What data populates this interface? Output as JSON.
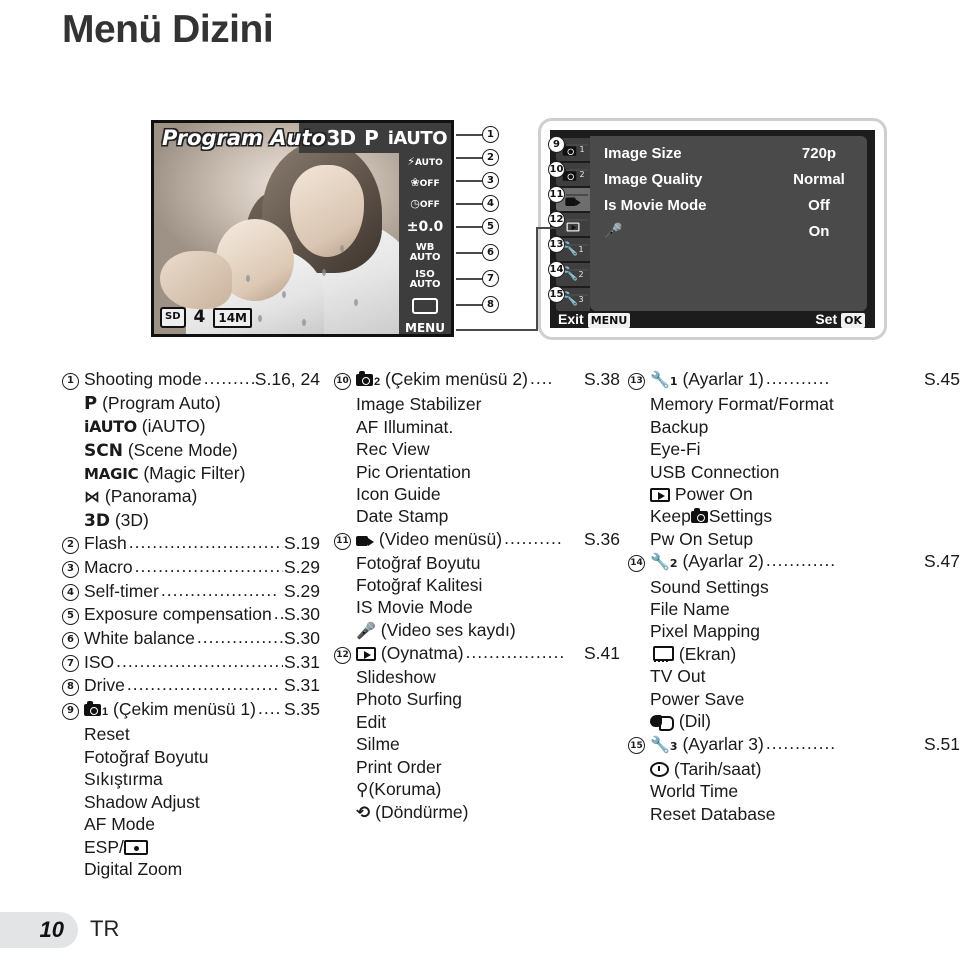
{
  "page": {
    "title": "Menü Dizini",
    "page_number": "10",
    "language_code": "TR"
  },
  "live_view": {
    "mode_title": "Program Auto",
    "top_icons": [
      "3D",
      "P",
      "iAUTO"
    ],
    "side_items": [
      {
        "num": "2",
        "line1": "AUTO",
        "icon": "flash-icon"
      },
      {
        "num": "3",
        "line1": "OFF",
        "icon": "macro-icon"
      },
      {
        "num": "4",
        "line1": "OFF",
        "icon": "self-timer-icon"
      },
      {
        "num": "5",
        "line1": "±0.0",
        "icon": "exposure-compensation-icon"
      },
      {
        "num": "6",
        "line1": "WB",
        "line2": "AUTO",
        "icon": "white-balance-icon"
      },
      {
        "num": "7",
        "line1": "ISO",
        "line2": "AUTO",
        "icon": "iso-icon"
      },
      {
        "num": "8",
        "line1": "",
        "icon": "drive-icon"
      }
    ],
    "menu_hint": "MENU",
    "badges": {
      "card": "SD",
      "battery": "4",
      "image_size": "14M"
    },
    "callout_1": "1"
  },
  "menu_screen": {
    "tabs": [
      {
        "num": "9",
        "label": "camera1-tab-icon"
      },
      {
        "num": "10",
        "label": "camera2-tab-icon"
      },
      {
        "num": "11",
        "label": "movie-tab-icon"
      },
      {
        "num": "12",
        "label": "playback-tab-icon"
      },
      {
        "num": "13",
        "label": "settings1-tab-icon"
      },
      {
        "num": "14",
        "label": "settings2-tab-icon"
      },
      {
        "num": "15",
        "label": "settings3-tab-icon"
      }
    ],
    "rows": [
      {
        "label": "Image Size",
        "value": "720p"
      },
      {
        "label": "Image Quality",
        "value": "Normal"
      },
      {
        "label": "Is Movie Mode",
        "value": "Off"
      },
      {
        "label": "",
        "value": "On",
        "icon": "microphone-icon"
      }
    ],
    "footer_left": "Exit",
    "footer_left_key": "MENU",
    "footer_right": "Set",
    "footer_right_key": "OK"
  },
  "index": {
    "column1": [
      {
        "num": "1",
        "label": "Shooting mode",
        "page": "S.16, 24"
      },
      {
        "sub": true,
        "icon": "mode-p-icon",
        "icon_text": "P",
        "label": "(Program Auto)"
      },
      {
        "sub": true,
        "icon": "mode-iauto-icon",
        "icon_text": "iAUTO",
        "label": "(iAUTO)"
      },
      {
        "sub": true,
        "icon": "mode-scn-icon",
        "icon_text": "SCN",
        "label": "(Scene Mode)"
      },
      {
        "sub": true,
        "icon": "mode-magic-icon",
        "icon_text": "MAGIC",
        "label": "(Magic Filter)"
      },
      {
        "sub": true,
        "icon": "mode-panorama-icon",
        "icon_text": "⋈",
        "label": "(Panorama)"
      },
      {
        "sub": true,
        "icon": "mode-3d-icon",
        "icon_text": "3D",
        "label": "(3D)"
      },
      {
        "num": "2",
        "label": "Flash",
        "page": "S.19"
      },
      {
        "num": "3",
        "label": "Macro",
        "page": "S.29"
      },
      {
        "num": "4",
        "label": "Self-timer",
        "page": "S.29"
      },
      {
        "num": "5",
        "label": "Exposure compensation",
        "page": "S.30"
      },
      {
        "num": "6",
        "label": "White balance",
        "page": "S.30"
      },
      {
        "num": "7",
        "label": "ISO",
        "page": "S.31"
      },
      {
        "num": "8",
        "label": "Drive",
        "page": "S.31"
      },
      {
        "num": "9",
        "icon": "camera-menu1-icon",
        "label": "(Çekim menüsü 1)",
        "page": "S.35"
      },
      {
        "sub": true,
        "label": "Reset"
      },
      {
        "sub": true,
        "label": "Fotoğraf Boyutu"
      },
      {
        "sub": true,
        "label": "Sıkıştırma"
      },
      {
        "sub": true,
        "label": "Shadow Adjust"
      },
      {
        "sub": true,
        "label": "AF Mode"
      },
      {
        "sub": true,
        "icon": "esp-metering-icon",
        "label": "ESP/"
      },
      {
        "sub": true,
        "label": "Digital Zoom"
      }
    ],
    "column2": [
      {
        "num": "10",
        "icon": "camera-menu2-icon",
        "label": "(Çekim menüsü 2)",
        "page": "S.38"
      },
      {
        "sub": true,
        "label": "Image Stabilizer"
      },
      {
        "sub": true,
        "label": "AF Illuminat."
      },
      {
        "sub": true,
        "label": "Rec View"
      },
      {
        "sub": true,
        "label": "Pic Orientation"
      },
      {
        "sub": true,
        "label": "Icon Guide"
      },
      {
        "sub": true,
        "label": "Date Stamp"
      },
      {
        "num": "11",
        "icon": "movie-menu-icon",
        "label": "(Video menüsü)",
        "page": "S.36"
      },
      {
        "sub": true,
        "label": "Fotoğraf Boyutu"
      },
      {
        "sub": true,
        "label": "Fotoğraf Kalitesi"
      },
      {
        "sub": true,
        "label": "IS Movie Mode"
      },
      {
        "sub": true,
        "icon": "microphone-icon",
        "label": "(Video ses kaydı)"
      },
      {
        "num": "12",
        "icon": "playback-menu-icon",
        "label": "(Oynatma)",
        "page": "S.41"
      },
      {
        "sub": true,
        "label": "Slideshow"
      },
      {
        "sub": true,
        "label": "Photo Surfing"
      },
      {
        "sub": true,
        "label": "Edit"
      },
      {
        "sub": true,
        "label": "Silme"
      },
      {
        "sub": true,
        "label": "Print Order"
      },
      {
        "sub": true,
        "icon": "protect-key-icon",
        "label": "(Koruma)"
      },
      {
        "sub": true,
        "icon": "rotate-icon",
        "label": "(Döndürme)"
      }
    ],
    "column3": [
      {
        "num": "13",
        "icon": "settings1-icon",
        "label": "(Ayarlar 1)",
        "page": "S.45"
      },
      {
        "sub": true,
        "label": "Memory Format/Format"
      },
      {
        "sub": true,
        "label": "Backup"
      },
      {
        "sub": true,
        "label": "Eye-Fi"
      },
      {
        "sub": true,
        "label": "USB Connection"
      },
      {
        "sub": true,
        "icon": "playback-menu-icon",
        "label": "Power On"
      },
      {
        "sub": true,
        "icon": "camera-inline-icon",
        "label": "Keep",
        "label2": "Settings"
      },
      {
        "sub": true,
        "label": "Pw On Setup"
      },
      {
        "num": "14",
        "icon": "settings2-icon",
        "label": "(Ayarlar 2)",
        "page": "S.47"
      },
      {
        "sub": true,
        "label": "Sound Settings"
      },
      {
        "sub": true,
        "label": "File Name"
      },
      {
        "sub": true,
        "label": "Pixel Mapping"
      },
      {
        "sub": true,
        "icon": "screen-icon",
        "label": "(Ekran)"
      },
      {
        "sub": true,
        "label": "TV Out"
      },
      {
        "sub": true,
        "label": "Power Save"
      },
      {
        "sub": true,
        "icon": "language-icon",
        "label": "(Dil)"
      },
      {
        "num": "15",
        "icon": "settings3-icon",
        "label": "(Ayarlar 3)",
        "page": "S.51"
      },
      {
        "sub": true,
        "icon": "clock-icon",
        "label": "(Tarih/saat)"
      },
      {
        "sub": true,
        "label": "World Time"
      },
      {
        "sub": true,
        "label": "Reset Database"
      }
    ]
  }
}
